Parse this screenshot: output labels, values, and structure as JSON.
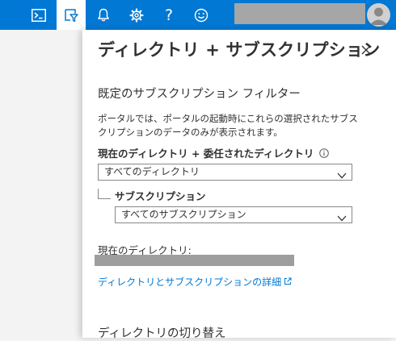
{
  "header": {
    "buttons": [
      {
        "name": "cloud-shell-button",
        "icon": "terminal-icon"
      },
      {
        "name": "directory-filter-button",
        "icon": "filter-book-icon"
      },
      {
        "name": "notifications-button",
        "icon": "bell-icon"
      },
      {
        "name": "settings-button",
        "icon": "gear-icon"
      },
      {
        "name": "help-button",
        "icon": "question-icon"
      },
      {
        "name": "feedback-button",
        "icon": "smiley-icon"
      }
    ],
    "help_glyph": "?"
  },
  "panel": {
    "title": "ディレクトリ + サブスクリプション",
    "filter_section_title": "既定のサブスクリプション フィルター",
    "filter_description": "ポータルでは、ポータルの起動時にこれらの選択されたサブスクリプションのデータのみが表示されます。",
    "directory_label": "現在のディレクトリ + 委任されたディレクトリ",
    "directory_select_value": "すべてのディレクトリ",
    "subscription_label": "サブスクリプション",
    "subscription_select_value": "すべてのサブスクリプション",
    "current_directory_label": "現在のディレクトリ:",
    "details_link": "ディレクトリとサブスクリプションの詳細",
    "switch_section_title": "ディレクトリの切り替え"
  },
  "colors": {
    "accent": "#0078d4",
    "text": "#323130",
    "border": "#8a8886"
  }
}
